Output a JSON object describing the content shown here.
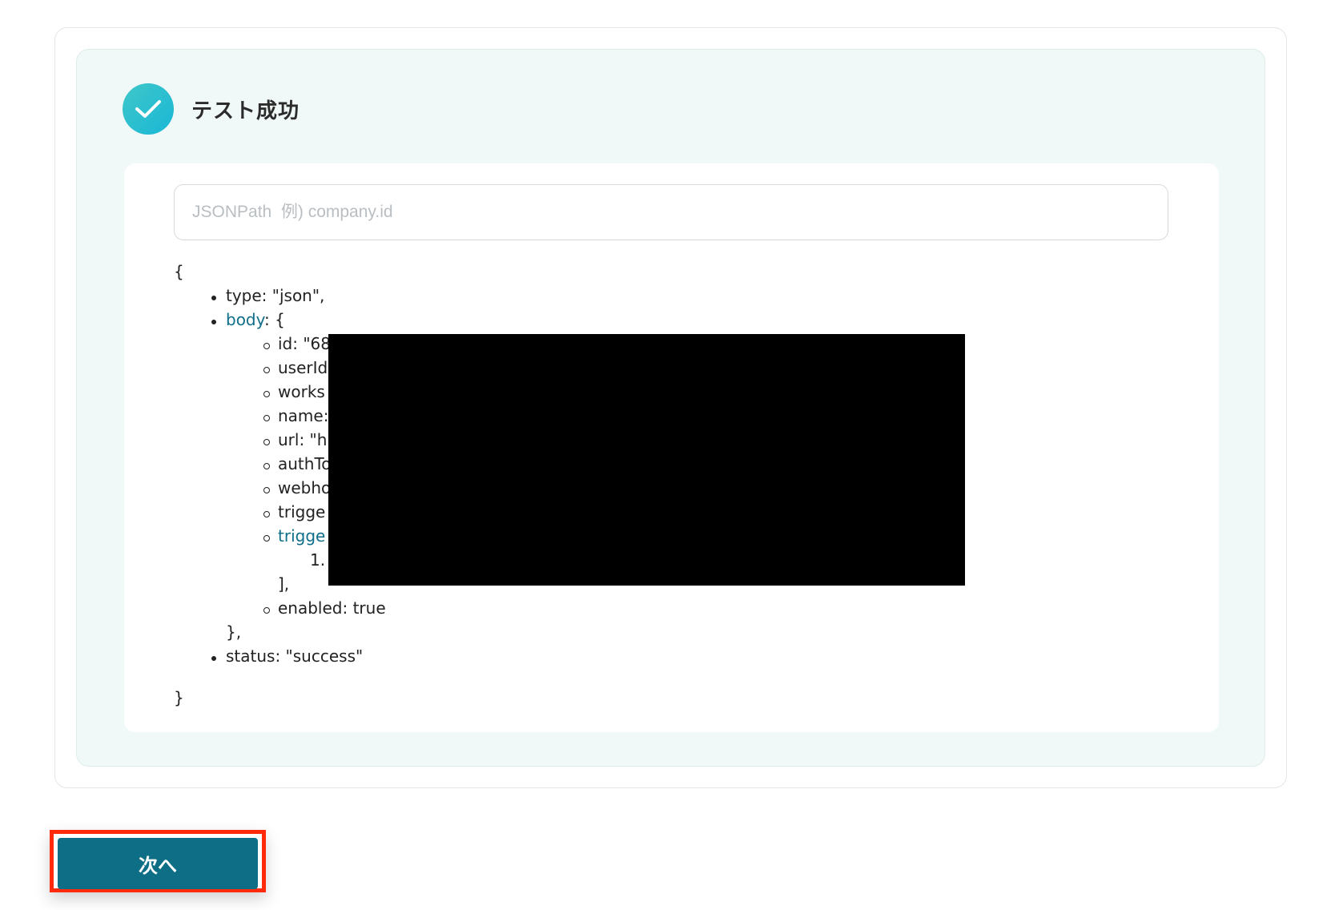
{
  "status": {
    "title": "テスト成功",
    "icon": "check-circle-icon",
    "accent": "#1fbfd4"
  },
  "search": {
    "placeholder": "JSONPath  例) company.id",
    "value": ""
  },
  "json_view": {
    "open_brace": "{",
    "close_brace": "}",
    "type_line": "type: \"json\",",
    "body_key": "body",
    "body_open": ": {",
    "body_fields": [
      "id: \"68",
      "userId",
      "works",
      "name:",
      "url: \"h",
      "authTo",
      "webho",
      "trigge"
    ],
    "array_key": "trigge",
    "array_item": "1.",
    "array_close": "],",
    "enabled_line": "enabled: true",
    "body_close": "},",
    "status_line": "status: \"success\""
  },
  "actions": {
    "next_label": "次へ"
  },
  "colors": {
    "primary_button": "#0e6e86",
    "highlight_border": "#ff2a0c",
    "panel_bg": "#f1f9f8",
    "key_link": "#0f6e8a"
  }
}
